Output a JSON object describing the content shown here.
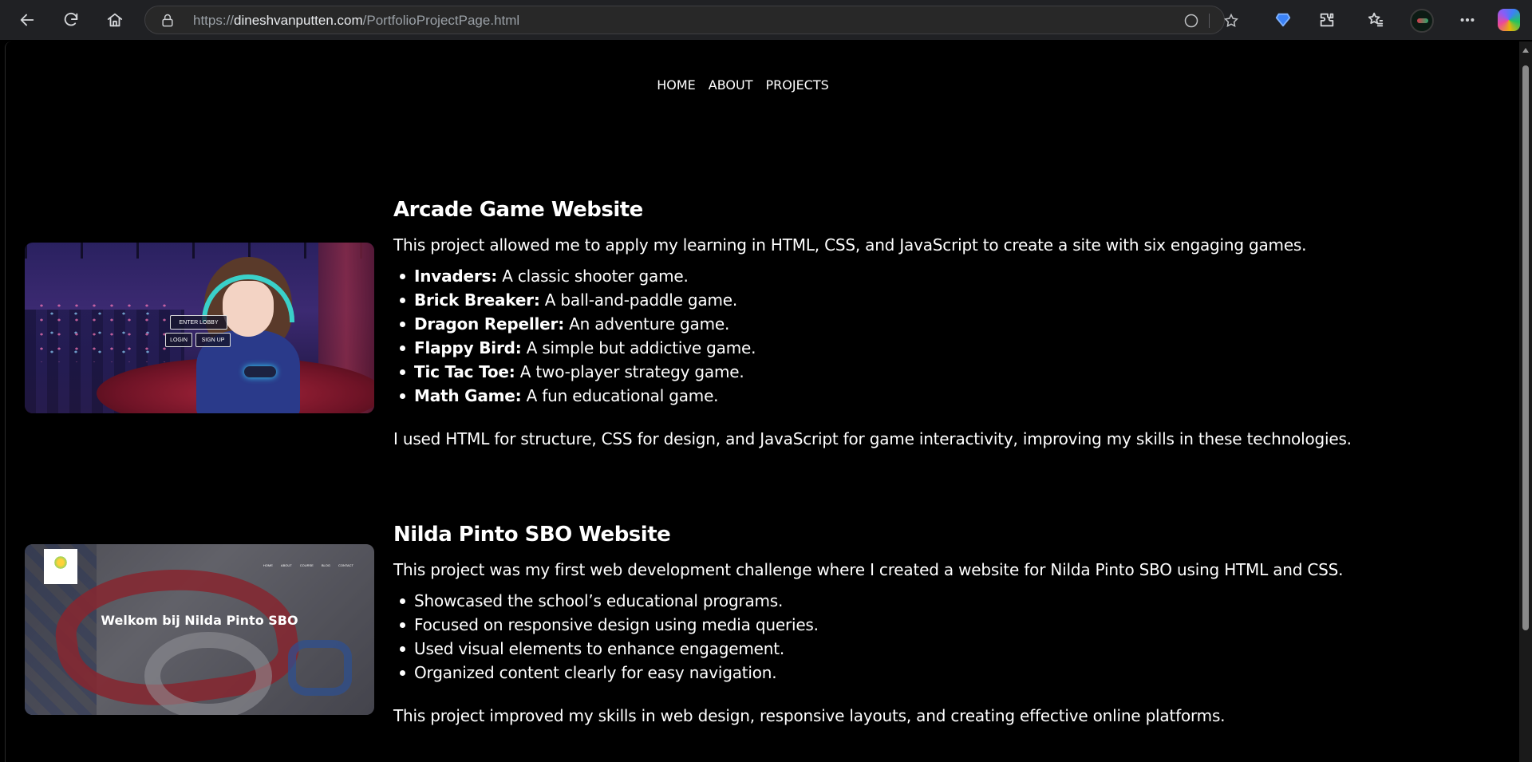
{
  "browser": {
    "url_protocol": "https://",
    "url_host": "dineshvanputten.com",
    "url_path": "/PortfolioProjectPage.html"
  },
  "nav": {
    "items": [
      "HOME",
      "ABOUT",
      "PROJECTS"
    ]
  },
  "projects": [
    {
      "title": "Arcade Game Website",
      "intro": "This project allowed me to apply my learning in HTML, CSS, and JavaScript to create a site with six engaging games.",
      "items": [
        {
          "name": "Invaders:",
          "desc": " A classic shooter game."
        },
        {
          "name": "Brick Breaker:",
          "desc": " A ball-and-paddle game."
        },
        {
          "name": "Dragon Repeller:",
          "desc": " An adventure game."
        },
        {
          "name": "Flappy Bird:",
          "desc": " A simple but addictive game."
        },
        {
          "name": "Tic Tac Toe:",
          "desc": " A two-player strategy game."
        },
        {
          "name": "Math Game:",
          "desc": " A fun educational game."
        }
      ],
      "outro": "I used HTML for structure, CSS for design, and JavaScript for game interactivity, improving my skills in these technologies.",
      "image": {
        "enter_lobby": "ENTER LOBBY",
        "login": "LOGIN",
        "signup": "SIGN UP"
      }
    },
    {
      "title": "Nilda Pinto SBO Website",
      "intro": "This project was my first web development challenge where I created a website for Nilda Pinto SBO using HTML and CSS.",
      "items": [
        {
          "name": "",
          "desc": "Showcased the school’s educational programs."
        },
        {
          "name": "",
          "desc": "Focused on responsive design using media queries."
        },
        {
          "name": "",
          "desc": "Used visual elements to enhance engagement."
        },
        {
          "name": "",
          "desc": "Organized content clearly for easy navigation."
        }
      ],
      "outro": "This project improved my skills in web design, responsive layouts, and creating effective online platforms.",
      "image": {
        "welcome": "Welkom bij Nilda Pinto SBO",
        "mini_nav": [
          "HOME",
          "ABOUT",
          "COURSE",
          "BLOG",
          "CONTACT"
        ]
      }
    }
  ]
}
